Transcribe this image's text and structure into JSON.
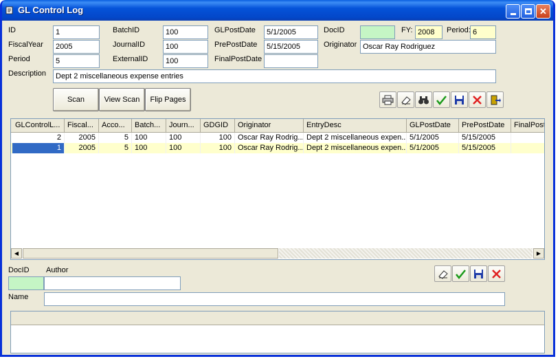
{
  "window": {
    "title": "GL Control Log"
  },
  "form": {
    "id_label": "ID",
    "id_value": "1",
    "fiscalyear_label": "FiscalYear",
    "fiscalyear_value": "2005",
    "period_label": "Period",
    "period_value": "5",
    "batchid_label": "BatchID",
    "batchid_value": "100",
    "journalid_label": "JournalID",
    "journalid_value": "100",
    "externalid_label": "ExternalID",
    "externalid_value": "100",
    "glpostdate_label": "GLPostDate",
    "glpostdate_value": "5/1/2005",
    "prepostdate_label": "PrePostDate",
    "prepostdate_value": "5/15/2005",
    "finalpostdate_label": "FinalPostDate",
    "finalpostdate_value": "",
    "docid_label": "DocID",
    "docid_value": "",
    "fy_label": "FY:",
    "fy_value": "2008",
    "period2_label": "Period:",
    "period2_value": "6",
    "originator_label": "Originator",
    "originator_value": "Oscar Ray Rodriguez",
    "description_label": "Description",
    "description_value": "Dept 2 miscellaneous expense entries"
  },
  "buttons": {
    "scan": "Scan",
    "view_scan": "View Scan",
    "flip_pages": "Flip Pages"
  },
  "toolbar_icons": [
    "printer-icon",
    "eraser-icon",
    "binoculars-icon",
    "checkmark-icon",
    "save-disk-icon",
    "delete-x-icon",
    "exit-door-icon"
  ],
  "grid": {
    "columns": [
      "GLControlL...",
      "Fiscal...",
      "Acco...",
      "Batch...",
      "Journ...",
      "GDGID",
      "Originator",
      "EntryDesc",
      "GLPostDate",
      "PrePostDate",
      "FinalPost"
    ],
    "rows": [
      [
        "2",
        "2005",
        "5",
        "100",
        "100",
        "100",
        "Oscar Ray Rodrig...",
        "Dept 2 miscellaneous expen...",
        "5/1/2005",
        "5/15/2005",
        ""
      ],
      [
        "1",
        "2005",
        "5",
        "100",
        "100",
        "100",
        "Oscar Ray Rodrig...",
        "Dept 2 miscellaneous expen...",
        "5/1/2005",
        "5/15/2005",
        ""
      ]
    ]
  },
  "doc": {
    "docid_label": "DocID",
    "docid_value": "",
    "author_label": "Author",
    "author_value": "",
    "name_label": "Name",
    "name_value": ""
  },
  "colors": {
    "title_bar": "#0a5fe0",
    "selected_row": "#316ac5",
    "highlight_row": "#ffffcc",
    "docid_field": "#c5f5c5"
  }
}
